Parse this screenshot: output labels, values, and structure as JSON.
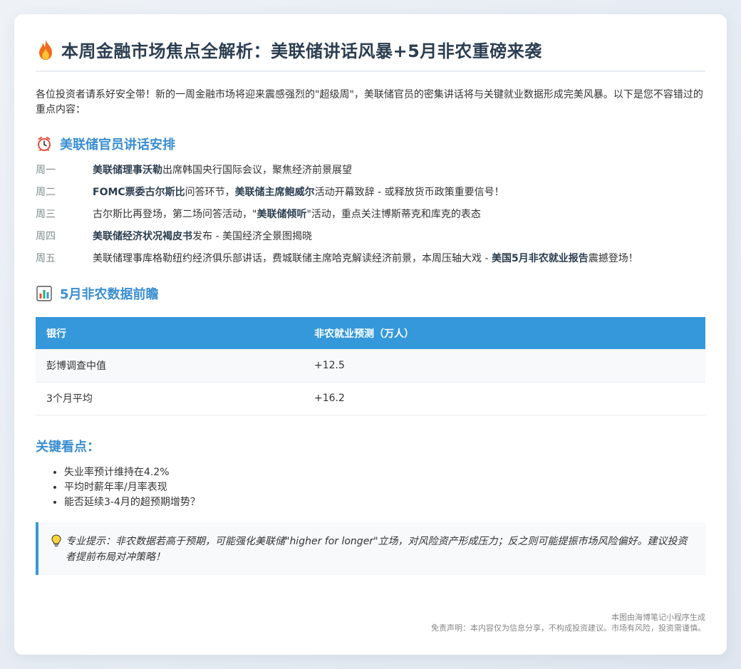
{
  "title": "本周金融市场焦点全解析：美联储讲话风暴+5月非农重磅来袭",
  "intro": "各位投资者请系好安全带！新的一周金融市场将迎来震感强烈的\"超级周\"，美联储官员的密集讲话将与关键就业数据形成完美风暴。以下是您不容错过的重点内容：",
  "speech_section": {
    "title": "美联储官员讲话安排",
    "icon": "alarm-clock-icon",
    "schedule": [
      {
        "day": "周一",
        "parts": [
          {
            "text": "美联储理事沃勒",
            "bold": true
          },
          {
            "text": "出席韩国央行国际会议，聚焦经济前景展望",
            "bold": false
          }
        ]
      },
      {
        "day": "周二",
        "parts": [
          {
            "text": "FOMC票委古尔斯比",
            "bold": true
          },
          {
            "text": "问答环节，",
            "bold": false
          },
          {
            "text": "美联储主席鲍威尔",
            "bold": true
          },
          {
            "text": "活动开幕致辞 - 或释放货币政策重要信号！",
            "bold": false
          }
        ]
      },
      {
        "day": "周三",
        "parts": [
          {
            "text": "古尔斯比再登场，第二场问答活动，\"",
            "bold": false
          },
          {
            "text": "美联储倾听",
            "bold": true
          },
          {
            "text": "\"活动，重点关注博斯蒂克和库克的表态",
            "bold": false
          }
        ]
      },
      {
        "day": "周四",
        "parts": [
          {
            "text": "美联储经济状况褐皮书",
            "bold": true
          },
          {
            "text": "发布 - 美国经济全景图揭晓",
            "bold": false
          }
        ]
      },
      {
        "day": "周五",
        "parts": [
          {
            "text": "美联储理事库格勒纽约经济俱乐部讲话，费城联储主席哈克解读经济前景，本周压轴大戏 - ",
            "bold": false
          },
          {
            "text": "美国5月非农就业报告",
            "bold": true
          },
          {
            "text": "震撼登场！",
            "bold": false
          }
        ]
      }
    ]
  },
  "nfp_section": {
    "title": "5月非农数据前瞻",
    "icon": "bar-chart-icon",
    "table": {
      "headers": [
        "银行",
        "非农就业预测（万人）"
      ],
      "rows": [
        [
          "彭博调查中值",
          "+12.5"
        ],
        [
          "3个月平均",
          "+16.2"
        ]
      ]
    }
  },
  "key_points": {
    "title": "关键看点：",
    "items": [
      "失业率预计维持在4.2%",
      "平均时薪年率/月率表现",
      "能否延续3-4月的超预期增势？"
    ]
  },
  "tip": {
    "icon": "lightbulb-icon",
    "text": "专业提示：非农数据若高于预期，可能强化美联储\"higher for longer\"立场，对风险资产形成压力；反之则可能提振市场风险偏好。建议投资者提前布局对冲策略！"
  },
  "footer": {
    "generated_by": "本图由海博笔记小程序生成",
    "disclaimer": "免责声明：本内容仅为信息分享，不构成投资建议。市场有风险，投资需谨慎。"
  },
  "colors": {
    "accent": "#3498db",
    "title_text": "#2c3e50",
    "day_text": "#7f8c8d"
  }
}
